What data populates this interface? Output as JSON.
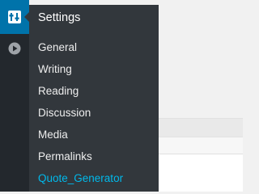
{
  "sidebar": {
    "icons": [
      {
        "name": "settings-icon",
        "active": true
      },
      {
        "name": "play-circle-icon",
        "active": false
      }
    ]
  },
  "flyout": {
    "title": "Settings",
    "items": [
      {
        "label": "General"
      },
      {
        "label": "Writing"
      },
      {
        "label": "Reading"
      },
      {
        "label": "Discussion"
      },
      {
        "label": "Media"
      },
      {
        "label": "Permalinks"
      },
      {
        "label": "Quote_Generator",
        "current": true
      }
    ]
  },
  "colors": {
    "sidebar_bg": "#23282d",
    "flyout_bg": "#32373c",
    "active_icon_bg": "#0073aa",
    "current_item": "#00b9eb",
    "item_text": "#eeeeee"
  }
}
